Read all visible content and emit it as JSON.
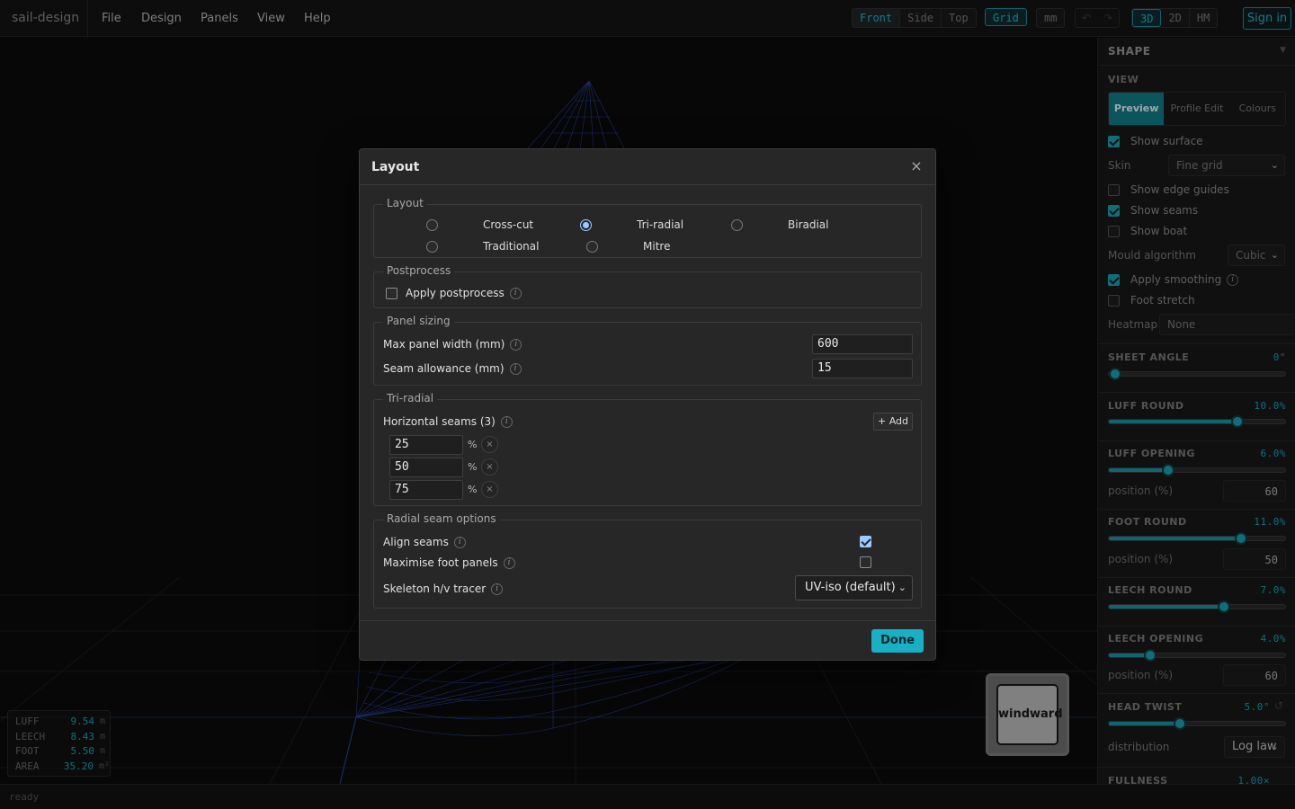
{
  "app": {
    "brand": "sail-design",
    "menus": [
      "File",
      "Design",
      "Panels",
      "View",
      "Help"
    ]
  },
  "toolbar": {
    "views": [
      "Front",
      "Side",
      "Top"
    ],
    "grid_label": "Grid",
    "unit_label": "mm",
    "undo_icon": "↶",
    "redo_icon": "↷",
    "modes": [
      "3D",
      "2D",
      "HM"
    ],
    "active_mode": "3D",
    "sign_in": "Sign in"
  },
  "readout": [
    {
      "key": "LUFF",
      "value": "9.54",
      "unit": "m"
    },
    {
      "key": "LEECH",
      "value": "8.43",
      "unit": "m"
    },
    {
      "key": "FOOT",
      "value": "5.50",
      "unit": "m"
    },
    {
      "key": "AREA",
      "value": "35.20",
      "unit": "m²"
    }
  ],
  "windward_label": "windward",
  "status": "ready",
  "panel": {
    "title": "SHAPE",
    "view_label": "VIEW",
    "tabs": [
      "Preview",
      "Profile Edit",
      "Colours"
    ],
    "active_tab": "Preview",
    "show_surface": {
      "label": "Show surface",
      "checked": true
    },
    "skin": {
      "label": "Skin",
      "value": "Fine grid"
    },
    "show_edge_guides": {
      "label": "Show edge guides",
      "checked": false
    },
    "show_seams": {
      "label": "Show seams",
      "checked": true
    },
    "show_boat": {
      "label": "Show boat",
      "checked": false
    },
    "mould": {
      "label": "Mould algorithm",
      "value": "Cubic"
    },
    "apply_smoothing": {
      "label": "Apply smoothing",
      "checked": true
    },
    "foot_stretch": {
      "label": "Foot stretch",
      "checked": false
    },
    "heatmap": {
      "label": "Heatmap",
      "value": "None"
    },
    "sliders": [
      {
        "label": "SHEET ANGLE",
        "value": "0°",
        "fraction": 0.0
      },
      {
        "label": "LUFF ROUND",
        "value": "10.0%",
        "fraction": 0.74
      },
      {
        "label": "LUFF OPENING",
        "value": "6.0%",
        "fraction": 0.32
      },
      {
        "label": "FOOT ROUND",
        "value": "11.0%",
        "fraction": 0.76
      },
      {
        "label": "LEECH ROUND",
        "value": "7.0%",
        "fraction": 0.66
      },
      {
        "label": "LEECH OPENING",
        "value": "4.0%",
        "fraction": 0.21
      },
      {
        "label": "HEAD TWIST",
        "value": "5.0°",
        "fraction": 0.39
      }
    ],
    "position_label": "position (%)",
    "luff_opening_position": "60",
    "foot_round_position": "50",
    "leech_opening_position": "60",
    "distribution": {
      "label": "distribution",
      "value": "Log law"
    },
    "fullness": {
      "label": "FULLNESS",
      "value": "1.00×"
    }
  },
  "dialog": {
    "title": "Layout",
    "close_icon": "×",
    "layout_group": {
      "legend": "Layout",
      "options": [
        "Cross-cut",
        "Tri-radial",
        "Biradial",
        "Traditional",
        "Mitre"
      ],
      "selected": "Tri-radial"
    },
    "postprocess": {
      "legend": "Postprocess",
      "apply_label": "Apply postprocess",
      "checked": false
    },
    "panel_sizing": {
      "legend": "Panel sizing",
      "max_width_label": "Max panel width (mm)",
      "max_width_value": "600",
      "seam_allowance_label": "Seam allowance (mm)",
      "seam_allowance_value": "15"
    },
    "triradial": {
      "legend": "Tri-radial",
      "horizontal_label": "Horizontal seams (3)",
      "add_label": "+ Add",
      "seams": [
        "25",
        "50",
        "75"
      ],
      "pct": "%",
      "remove_icon": "×"
    },
    "radial": {
      "legend": "Radial seam options",
      "align_label": "Align seams",
      "align_checked": true,
      "maximise_label": "Maximise foot panels",
      "maximise_checked": false,
      "tracer_label": "Skeleton h/v tracer",
      "tracer_value": "UV-iso (default)"
    },
    "done": "Done"
  }
}
